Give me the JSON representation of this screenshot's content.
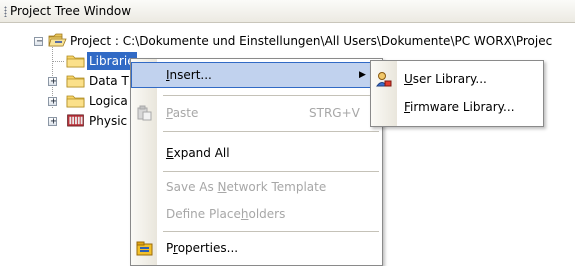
{
  "window": {
    "title": "Project Tree Window"
  },
  "tree": {
    "root_label": "Project : C:\\Dokumente und Einstellungen\\All Users\\Dokumente\\PC WORX\\Projec",
    "items": [
      {
        "label": "Libraries",
        "visible_label": "Librarie",
        "icon": "folder-icon",
        "selected": true
      },
      {
        "label": "Data T",
        "icon": "folder-icon"
      },
      {
        "label": "Logica",
        "icon": "folder-icon"
      },
      {
        "label": "Physic",
        "icon": "hardware-icon"
      }
    ],
    "expander_glyph": "+",
    "root_expander_glyph": "−"
  },
  "context_menu": {
    "items": [
      {
        "label": "Insert...",
        "mnemonic": "I",
        "rest": "nsert...",
        "state": "highlighted",
        "has_submenu": true
      },
      {
        "label": "Paste",
        "mnemonic": "P",
        "rest": "aste",
        "shortcut": "STRG+V",
        "state": "disabled",
        "icon": "paste-icon"
      },
      {
        "label": "Expand All",
        "mnemonic": "E",
        "rest": "xpand All",
        "state": "enabled"
      },
      {
        "label": "Save As Network Template",
        "before": "Save As ",
        "mnemonic": "N",
        "rest": "etwork Template",
        "state": "disabled"
      },
      {
        "label": "Define Placeholders",
        "before": "Define Place",
        "mnemonic": "h",
        "rest": "olders",
        "state": "disabled"
      },
      {
        "label": "Properties...",
        "before": "P",
        "mnemonic": "r",
        "rest": "operties...",
        "state": "enabled",
        "icon": "properties-icon"
      }
    ]
  },
  "submenu": {
    "items": [
      {
        "label": "User Library...",
        "mnemonic": "U",
        "rest": "ser Library...",
        "icon": "user-library-icon"
      },
      {
        "label": "Firmware Library...",
        "mnemonic": "F",
        "rest": "irmware Library..."
      }
    ]
  },
  "colors": {
    "selection": "#316ac5",
    "menu_highlight": "#c1d2ee",
    "disabled_text": "#a7a7a7"
  }
}
